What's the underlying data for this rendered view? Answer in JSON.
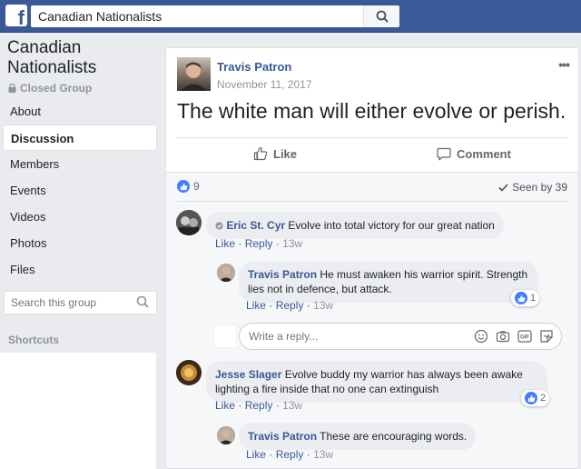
{
  "topbar": {
    "logo": "f",
    "search_value": "Canadian Nationalists",
    "search_icon": "search-icon"
  },
  "sidebar": {
    "group_name_line1": "Canadian",
    "group_name_line2": "Nationalists",
    "group_type": "Closed Group",
    "items": [
      {
        "label": "About"
      },
      {
        "label": "Discussion"
      },
      {
        "label": "Members"
      },
      {
        "label": "Events"
      },
      {
        "label": "Videos"
      },
      {
        "label": "Photos"
      },
      {
        "label": "Files"
      }
    ],
    "search_placeholder": "Search this group",
    "shortcuts_label": "Shortcuts"
  },
  "post": {
    "author": "Travis Patron",
    "date": "November 11, 2017",
    "text": "The white man will either evolve or perish.",
    "like_label": "Like",
    "comment_label": "Comment",
    "like_count": "9",
    "seen_by": "Seen by 39"
  },
  "comments": [
    {
      "author": "Eric St. Cyr",
      "text": "Evolve into total victory for our great nation",
      "like": "Like",
      "reply": "Reply",
      "time": "13w"
    },
    {
      "author": "Travis Patron",
      "text": "He must awaken his warrior spirit. Strength lies not in defence, but attack.",
      "like": "Like",
      "reply": "Reply",
      "time": "13w",
      "reactions": "1"
    },
    {
      "author": "Jesse Slager",
      "text": "Evolve buddy my warrior has always been awake lighting a fire inside that no one can extinguish",
      "like": "Like",
      "reply": "Reply",
      "time": "13w",
      "reactions": "2"
    },
    {
      "author": "Travis Patron",
      "text": "These are encouraging words.",
      "like": "Like",
      "reply": "Reply",
      "time": "13w"
    }
  ],
  "reply_box": {
    "placeholder": "Write a reply..."
  },
  "meta_sep": "·",
  "colors": {
    "topbar": "#3b5998",
    "link": "#365899",
    "like_blue": "#4080ff"
  }
}
